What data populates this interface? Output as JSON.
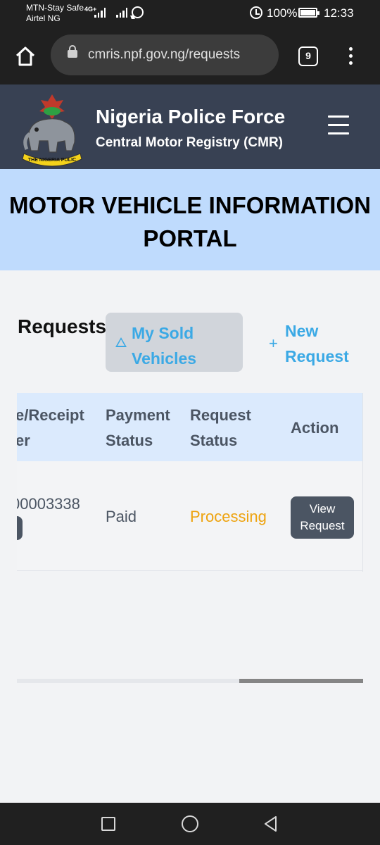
{
  "status_bar": {
    "carrier_1": "MTN-Stay Safe",
    "carrier_2": "Airtel NG",
    "network_tag": "4G+",
    "battery": "100%",
    "time": "12:33",
    "icons": [
      "signal-icon",
      "whatsapp-icon",
      "alarm-icon",
      "battery-icon"
    ]
  },
  "browser": {
    "url": "cmris.npf.gov.ng/requests",
    "tab_count": "9",
    "icons": [
      "home-icon",
      "lock-icon",
      "tabs-icon",
      "more-vertical-icon"
    ]
  },
  "site": {
    "title": "Nigeria Police Force",
    "subtitle": "Central Motor Registry (CMR)",
    "logo_ribbon_text": "THE NIGERIA POLIC",
    "header_bg": "#384153"
  },
  "banner": {
    "title_line_1": "MOTOR VEHICLE INFORMATION",
    "title_line_2": "PORTAL",
    "bg": "#bfdbfd"
  },
  "requests": {
    "heading": "Requests",
    "sold_button": {
      "line_1": "My Sold",
      "line_2": "Vehicles",
      "icon": "warning-triangle-icon"
    },
    "new_button": {
      "line_1": "New",
      "line_2": "Request",
      "icon": "plus-icon"
    },
    "accent": "#3ba9e5"
  },
  "table": {
    "columns": [
      {
        "line_1": "e/Receipt",
        "line_2": "er"
      },
      {
        "line_1": "Payment",
        "line_2": "Status"
      },
      {
        "line_1": "Request",
        "line_2": "Status"
      },
      {
        "line_1": "Action"
      }
    ],
    "rows": [
      {
        "receipt": "00003338",
        "payment_status": "Paid",
        "request_status": "Processing",
        "action": {
          "line_1": "View",
          "line_2": "Request"
        }
      }
    ],
    "processing_color": "#eea30f"
  },
  "system_nav": {
    "icons": [
      "recent-apps-icon",
      "home-circle-icon",
      "back-icon"
    ]
  }
}
